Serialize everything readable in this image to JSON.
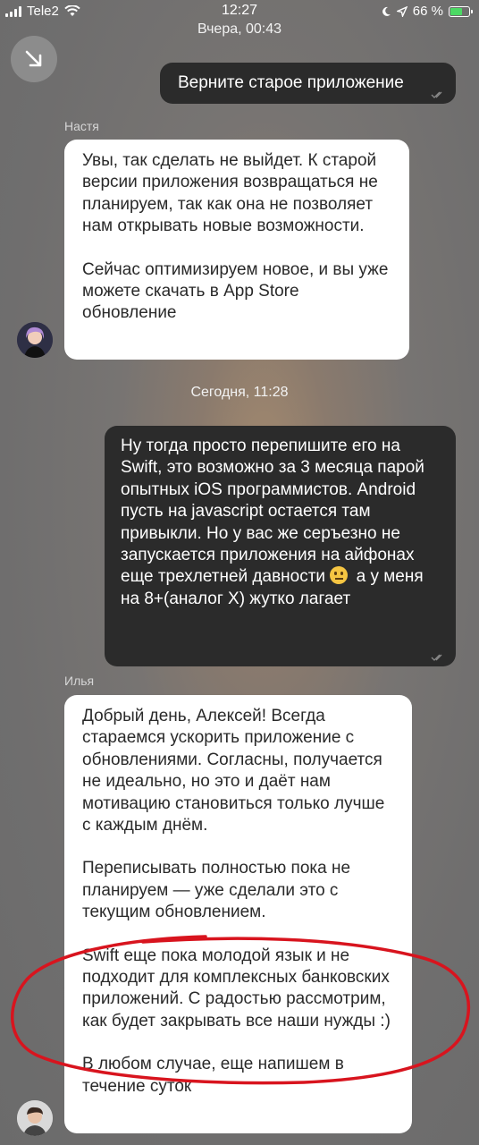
{
  "status_bar": {
    "carrier": "Tele2",
    "time": "12:27",
    "battery_percent": "66 %",
    "battery_level": 0.66,
    "icons": [
      "signal-icon",
      "wifi-icon",
      "moon-icon",
      "location-arrow-icon",
      "battery-icon"
    ]
  },
  "colors": {
    "outgoing_bubble": "#2b2b2b",
    "incoming_bubble": "#ffffff",
    "annotation": "#d8141e"
  },
  "dates": {
    "yesterday": "Вчера, 00:43",
    "today": "Сегодня, 11:28"
  },
  "messages": [
    {
      "direction": "out",
      "text": "Верните старое приложение"
    },
    {
      "direction": "in",
      "sender": "Настя",
      "paragraphs": [
        "Увы, так сделать не выйдет. К старой версии приложения возвращаться не планируем, так как она не позволяет нам открывать новые возможности.",
        "Сейчас оптимизируем новое, и вы уже можете скачать в App Store обновление"
      ]
    },
    {
      "direction": "out",
      "text_before_emoji": "Ну тогда просто перепишите его на Swift, это возможно за 3 месяца парой опытных iOS программистов. Android пусть на javascript остается там привыкли. Но у вас же серъезно не запускается приложения на айфонах еще трехлетней давности",
      "emoji": "neutral-face-emoji",
      "text_after_emoji": "а у меня на 8+(аналог X) жутко лагает"
    },
    {
      "direction": "in",
      "sender": "Илья",
      "paragraphs": [
        "Добрый день, Алексей! Всегда стараемся ускорить приложение с обновлениями. Согласны, получается не идеально, но это и даёт нам мотивацию становиться только лучше с каждым днём.",
        "Переписывать полностью пока не планируем — уже сделали это с текущим обновлением.",
        "Swift еще пока молодой язык и не подходит для комплексных банковских приложений. С радостью рассмотрим, как будет закрывать все наши нужды :)",
        "В любом случае, еще напишем в течение суток"
      ]
    }
  ]
}
